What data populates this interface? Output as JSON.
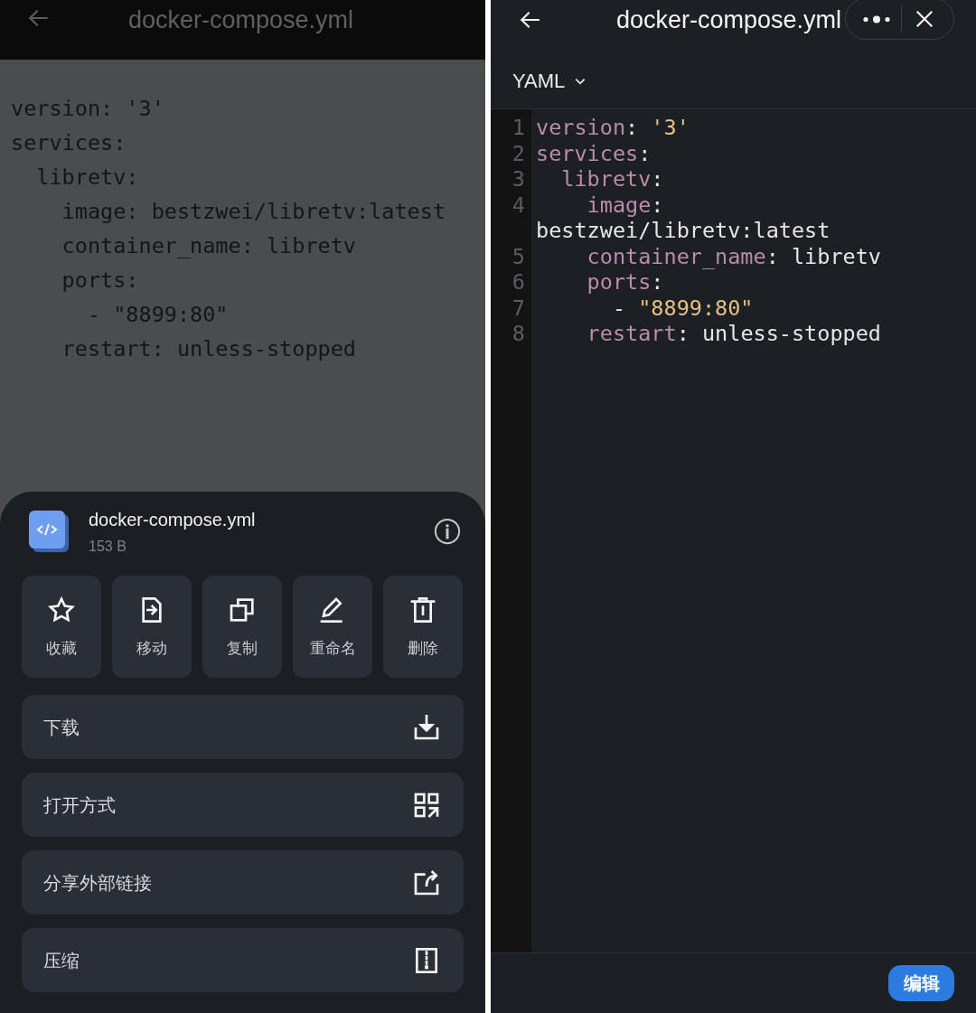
{
  "viewer_screen": {
    "top_bar": {
      "title": "docker-compose.yml"
    },
    "code_lines": [
      "version: '3'",
      "services:",
      "  libretv:",
      "    image: bestzwei/libretv:latest",
      "    container_name: libretv",
      "    ports:",
      "      - \"8899:80\"",
      "    restart: unless-stopped"
    ]
  },
  "file_sheet": {
    "file": {
      "name": "docker-compose.yml",
      "size": "153 B"
    },
    "actions": [
      {
        "kind": "star",
        "label": "收藏"
      },
      {
        "kind": "move",
        "label": "移动"
      },
      {
        "kind": "copy",
        "label": "复制"
      },
      {
        "kind": "rename",
        "label": "重命名"
      },
      {
        "kind": "delete",
        "label": "删除"
      }
    ],
    "menu_items": [
      {
        "kind": "download",
        "label": "下载"
      },
      {
        "kind": "open_with",
        "label": "打开方式"
      },
      {
        "kind": "share",
        "label": "分享外部链接"
      },
      {
        "kind": "compress",
        "label": "压缩"
      }
    ]
  },
  "editor_screen": {
    "header": {
      "title": "docker-compose.yml"
    },
    "language": "YAML",
    "lines": [
      {
        "number": "1",
        "tokens": [
          {
            "kind": "key",
            "text": "version"
          },
          {
            "kind": "plain",
            "text": ": "
          },
          {
            "kind": "string",
            "text": "'3'"
          }
        ]
      },
      {
        "number": "2",
        "tokens": [
          {
            "kind": "key",
            "text": "services"
          },
          {
            "kind": "plain",
            "text": ":"
          }
        ]
      },
      {
        "number": "3",
        "tokens": [
          {
            "kind": "key",
            "text": "  libretv"
          },
          {
            "kind": "plain",
            "text": ":"
          }
        ]
      },
      {
        "number": "4",
        "tokens": [
          {
            "kind": "key",
            "text": "    image"
          },
          {
            "kind": "plain",
            "text": ": bestzwei/libretv:latest"
          }
        ]
      },
      {
        "number": "5",
        "tokens": [
          {
            "kind": "key",
            "text": "    container_name"
          },
          {
            "kind": "plain",
            "text": ": libretv"
          }
        ]
      },
      {
        "number": "6",
        "tokens": [
          {
            "kind": "key",
            "text": "    ports"
          },
          {
            "kind": "plain",
            "text": ":"
          }
        ]
      },
      {
        "number": "7",
        "tokens": [
          {
            "kind": "plain",
            "text": "      - "
          },
          {
            "kind": "string",
            "text": "\"8899:80\""
          }
        ]
      },
      {
        "number": "8",
        "tokens": [
          {
            "kind": "key",
            "text": "    restart"
          },
          {
            "kind": "plain",
            "text": ": unless-stopped"
          }
        ]
      }
    ],
    "edit_button": "编辑"
  }
}
